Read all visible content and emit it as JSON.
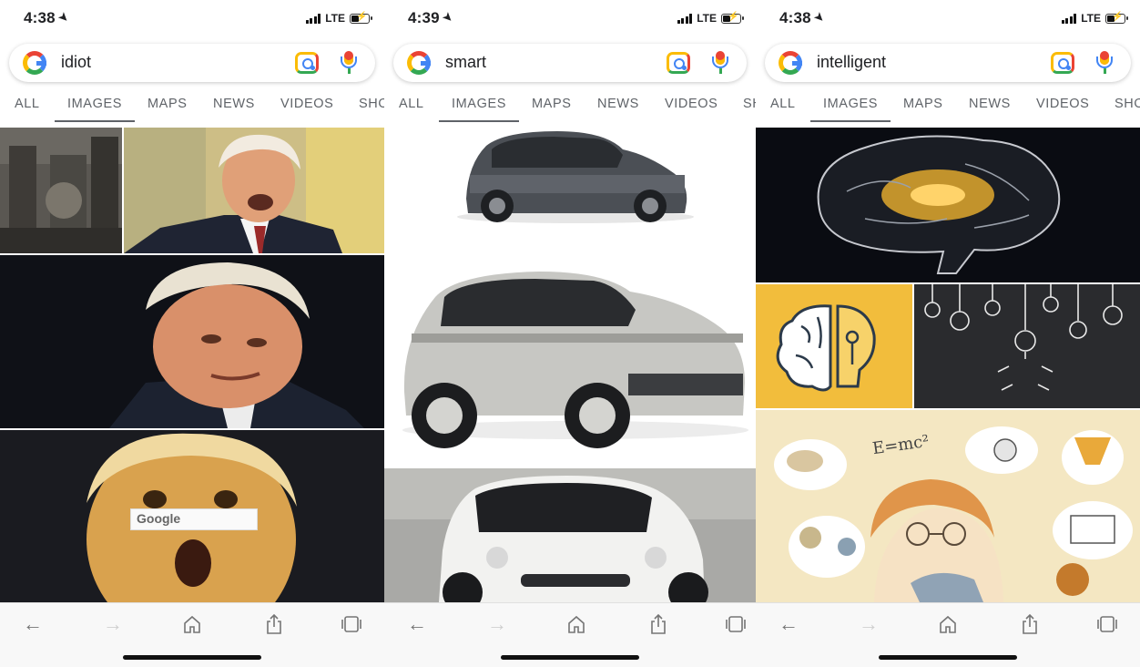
{
  "colors": {
    "accent_blue": "#4285f4",
    "accent_red": "#ea4335",
    "accent_yellow": "#fbbc05",
    "accent_green": "#34a853",
    "tab_text": "#5f6368"
  },
  "icons": {
    "location": "location-arrow-icon",
    "google": "google-logo-icon",
    "lens": "google-lens-icon",
    "mic": "microphone-icon",
    "back": "back-arrow-icon",
    "forward": "forward-arrow-icon",
    "home": "home-icon",
    "share": "share-icon",
    "tabs": "tabs-icon"
  },
  "screens": [
    {
      "status": {
        "time": "4:38",
        "network": "LTE"
      },
      "search": {
        "query": "idiot"
      },
      "tabs": [
        "ALL",
        "IMAGES",
        "MAPS",
        "NEWS",
        "VIDEOS",
        "SHOPPING"
      ],
      "active_tab": "IMAGES",
      "results": {
        "watermark_text": "Google"
      }
    },
    {
      "status": {
        "time": "4:39",
        "network": "LTE"
      },
      "search": {
        "query": "smart"
      },
      "tabs": [
        "ALL",
        "IMAGES",
        "MAPS",
        "NEWS",
        "VIDEOS",
        "SHOPPING"
      ],
      "active_tab": "IMAGES"
    },
    {
      "status": {
        "time": "4:38",
        "network": "LTE"
      },
      "search": {
        "query": "intelligent"
      },
      "tabs": [
        "ALL",
        "IMAGES",
        "MAPS",
        "NEWS",
        "VIDEOS",
        "SHOPPING"
      ],
      "active_tab": "IMAGES",
      "results": {
        "formula_text": "E=mc²"
      }
    }
  ]
}
